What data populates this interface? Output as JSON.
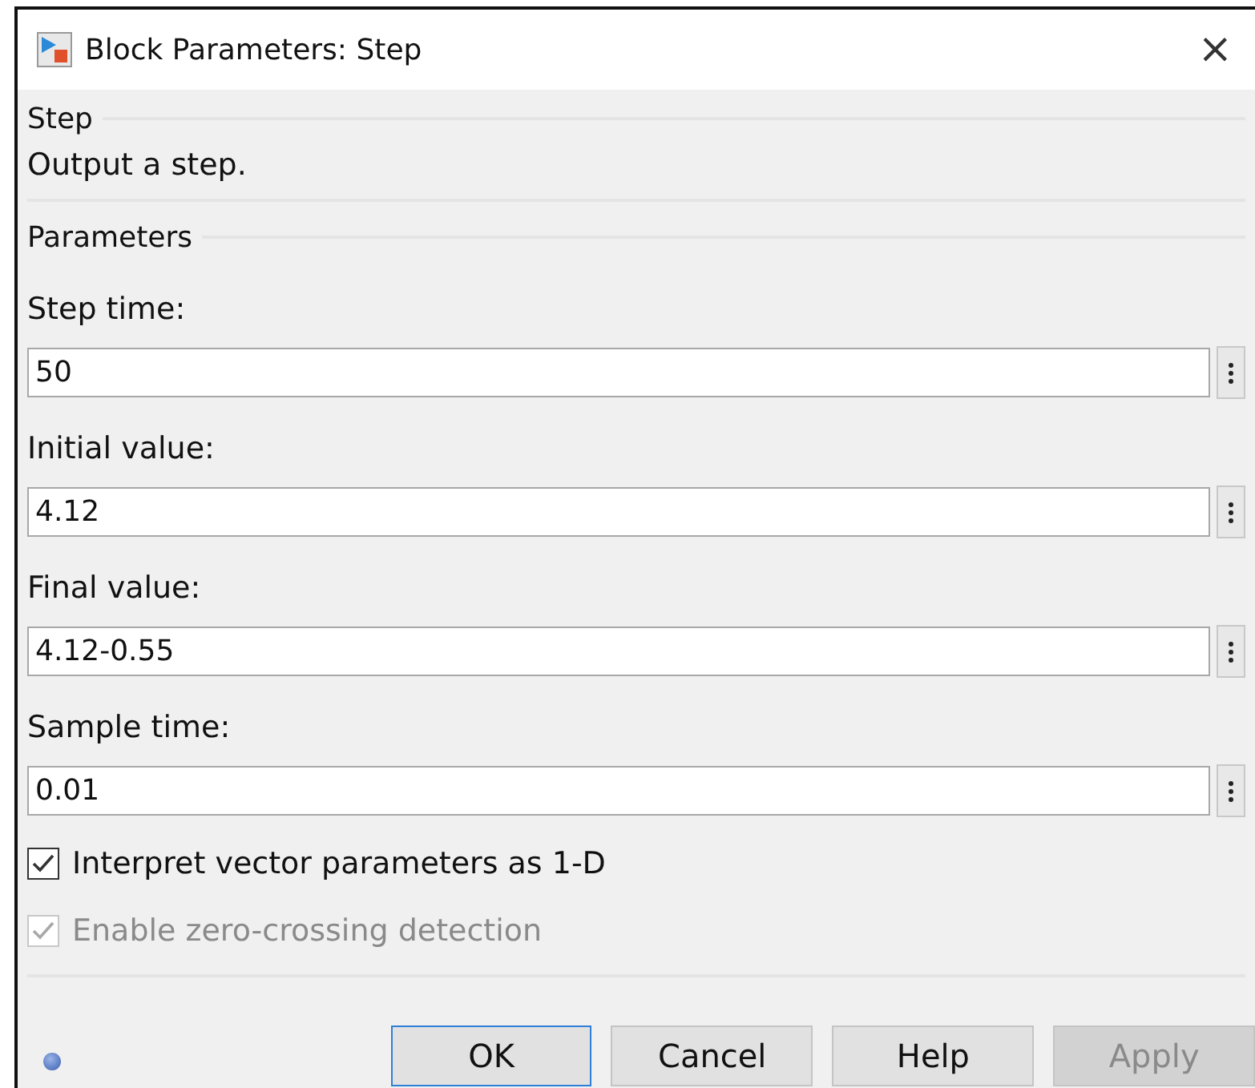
{
  "window": {
    "title": "Block Parameters: Step",
    "close": "×"
  },
  "block": {
    "group": "Step",
    "description": "Output a step."
  },
  "parameters": {
    "group": "Parameters",
    "fields": [
      {
        "label": "Step time:",
        "value": "50"
      },
      {
        "label": "Initial value:",
        "value": "4.12"
      },
      {
        "label": "Final value:",
        "value": "4.12-0.55"
      },
      {
        "label": "Sample time:",
        "value": "0.01"
      }
    ],
    "options": [
      {
        "label": "Interpret vector parameters as 1-D",
        "checked": true,
        "disabled": false
      },
      {
        "label": "Enable zero-crossing detection",
        "checked": true,
        "disabled": true
      }
    ]
  },
  "buttons": [
    {
      "label": "OK",
      "focused": true,
      "disabled": false
    },
    {
      "label": "Cancel",
      "focused": false,
      "disabled": false
    },
    {
      "label": "Help",
      "focused": false,
      "disabled": false
    },
    {
      "label": "Apply",
      "focused": false,
      "disabled": true
    }
  ]
}
